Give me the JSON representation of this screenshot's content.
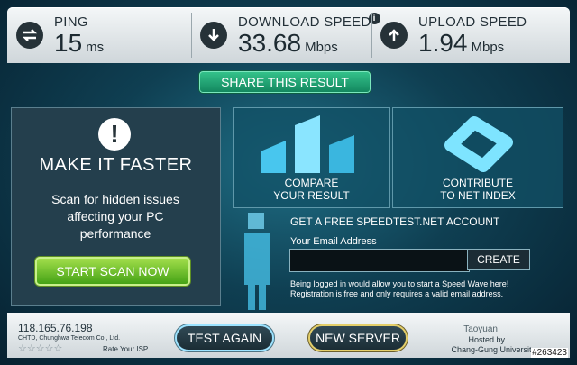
{
  "metrics": {
    "ping": {
      "label": "PING",
      "value": "15",
      "unit": "ms"
    },
    "download": {
      "label": "DOWNLOAD SPEED",
      "value": "33.68",
      "unit": "Mbps"
    },
    "upload": {
      "label": "UPLOAD SPEED",
      "value": "1.94",
      "unit": "Mbps"
    }
  },
  "info_label": "i",
  "share": {
    "label": "SHARE THIS RESULT"
  },
  "left": {
    "alert": "!",
    "title": "MAKE IT FASTER",
    "scan": "Scan for hidden issues affecting your PC performance",
    "button": "START SCAN NOW"
  },
  "compare": {
    "label1": "COMPARE",
    "label2": "YOUR RESULT"
  },
  "contribute": {
    "label1": "CONTRIBUTE",
    "label2": "TO NET INDEX"
  },
  "account": {
    "title": "GET A FREE SPEEDTEST.NET ACCOUNT",
    "email_label": "Your Email Address",
    "create": "CREATE",
    "note": "Being logged in would allow you to start a Speed Wave here! Registration is free and only requires a valid email address."
  },
  "bottom": {
    "ip": "118.165.76.198",
    "isp": "CHTD, Chunghwa Telecom Co., Ltd.",
    "stars": "☆☆☆☆☆",
    "rate": "Rate Your ISP",
    "test_again": "TEST AGAIN",
    "new_server": "NEW SERVER",
    "city": "Taoyuan",
    "hosted_by": "Hosted by",
    "host": "Chang-Gung University"
  },
  "watermark": "#263423"
}
